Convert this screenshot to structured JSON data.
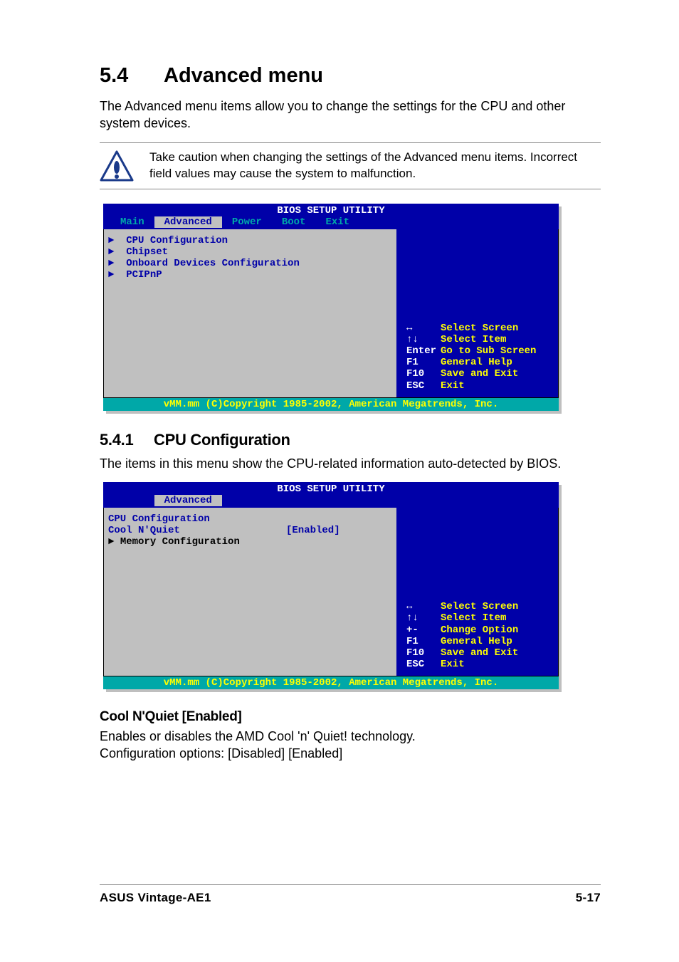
{
  "heading": {
    "num": "5.4",
    "title": "Advanced menu"
  },
  "intro": "The Advanced menu items allow you to change the settings for the CPU and other system devices.",
  "caution": "Take caution when changing the settings of the Advanced menu items. Incorrect field values may cause the system to malfunction.",
  "bios1": {
    "title": "BIOS SETUP UTILITY",
    "tabs": [
      "Main",
      "Advanced",
      "Power",
      "Boot",
      "Exit"
    ],
    "selected_tab": "Advanced",
    "items": [
      "CPU Configuration",
      "Chipset",
      "Onboard Devices Configuration",
      "PCIPnP"
    ],
    "help": [
      {
        "key": "↔",
        "desc": "Select Screen"
      },
      {
        "key": "↑↓",
        "desc": "Select Item"
      },
      {
        "key": "Enter",
        "desc": "Go to Sub Screen"
      },
      {
        "key": "F1",
        "desc": "General Help"
      },
      {
        "key": "F10",
        "desc": "Save and Exit"
      },
      {
        "key": "ESC",
        "desc": "Exit"
      }
    ],
    "footer": "vMM.mm (C)Copyright 1985-2002, American Megatrends, Inc."
  },
  "sub1": {
    "num": "5.4.1",
    "title": "CPU Configuration"
  },
  "sub1_text": "The items in this menu show the CPU-related information auto-detected by BIOS.",
  "bios2": {
    "title": "BIOS SETUP UTILITY",
    "selected_tab": "Advanced",
    "header": "CPU Configuration",
    "rows": [
      {
        "label": "Cool N'Quiet",
        "value": "[Enabled]"
      },
      {
        "label": "Memory Configuration",
        "value": "",
        "arrow": true
      }
    ],
    "help": [
      {
        "key": "↔",
        "desc": "Select Screen"
      },
      {
        "key": "↑↓",
        "desc": "Select Item"
      },
      {
        "key": "+-",
        "desc": "Change Option"
      },
      {
        "key": "F1",
        "desc": "General Help"
      },
      {
        "key": "F10",
        "desc": "Save and Exit"
      },
      {
        "key": "ESC",
        "desc": "Exit"
      }
    ],
    "footer": "vMM.mm (C)Copyright 1985-2002, American Megatrends, Inc."
  },
  "item1_title": "Cool N'Quiet [Enabled]",
  "item1_line1": "Enables or disables the AMD Cool 'n' Quiet! technology.",
  "item1_line2": "Configuration options: [Disabled] [Enabled]",
  "footer": {
    "left": "ASUS Vintage-AE1",
    "right": "5-17"
  }
}
